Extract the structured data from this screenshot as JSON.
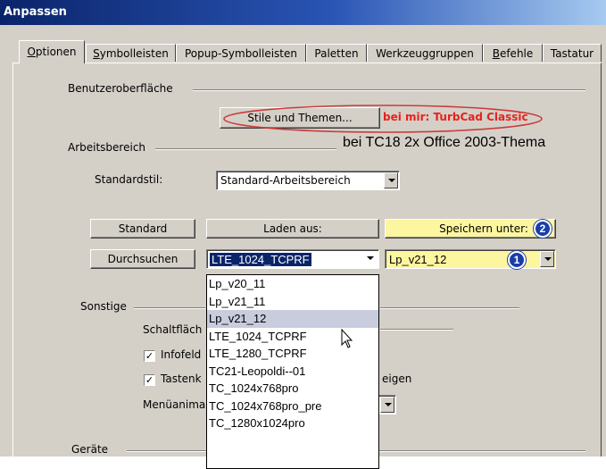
{
  "window": {
    "title": "Anpassen"
  },
  "tabs": [
    {
      "pre": "",
      "key": "O",
      "post": "ptionen"
    },
    {
      "pre": "",
      "key": "S",
      "post": "ymbolleisten"
    },
    {
      "pre": "Popup-Symbolleisten",
      "key": "",
      "post": ""
    },
    {
      "pre": "Paletten",
      "key": "",
      "post": ""
    },
    {
      "pre": "Werkzeuggruppen",
      "key": "",
      "post": ""
    },
    {
      "pre": "",
      "key": "B",
      "post": "efehle"
    },
    {
      "pre": "Tastatur",
      "key": "",
      "post": ""
    }
  ],
  "groups": {
    "benutzeroberflaeche": "Benutzeroberfläche",
    "arbeitsbereich": "Arbeitsbereich",
    "sonstige": "Sonstige",
    "geraete": "Geräte"
  },
  "stile_button": {
    "label": "Stile und Themen...",
    "note": "bei mir: TurbCad Classic"
  },
  "tc18_note": "bei TC18 2x Office 2003-Thema",
  "standardstil": {
    "label": "Standardstil:",
    "value": "Standard-Arbeitsbereich"
  },
  "buttons": {
    "standard": "Standard",
    "laden_aus": "Laden aus:",
    "speichern_unter": "Speichern unter:",
    "durchsuchen": "Durchsuchen"
  },
  "combos": {
    "laden_value": "LTE_1024_TCPRF",
    "speichern_value": "Lp_v21_12"
  },
  "badges": {
    "one": "1",
    "two": "2"
  },
  "dropdown_items": [
    "Lp_v20_11",
    "Lp_v21_11",
    "Lp_v21_12",
    "LTE_1024_TCPRF",
    "LTE_1280_TCPRF",
    "TC21-Leopoldi--01",
    "TC_1024x768pro",
    "TC_1024x768pro_pre",
    "TC_1280x1024pro"
  ],
  "hover_item": "Lp_v21_12",
  "sonstige": {
    "schaltflaeche": "Schaltfläch",
    "infofeld": "Infofeld",
    "tasten": "Tastenk",
    "tasten_tail": "eigen",
    "menueanim": "Menüanima"
  },
  "colors": {
    "annotation_red": "#e8211b",
    "annotation_ellipse": "#cc3b3b",
    "badge_blue": "#1a3ea8",
    "yellow_highlight": "#fdf6a0",
    "title_gradient_start": "#0a246a"
  }
}
